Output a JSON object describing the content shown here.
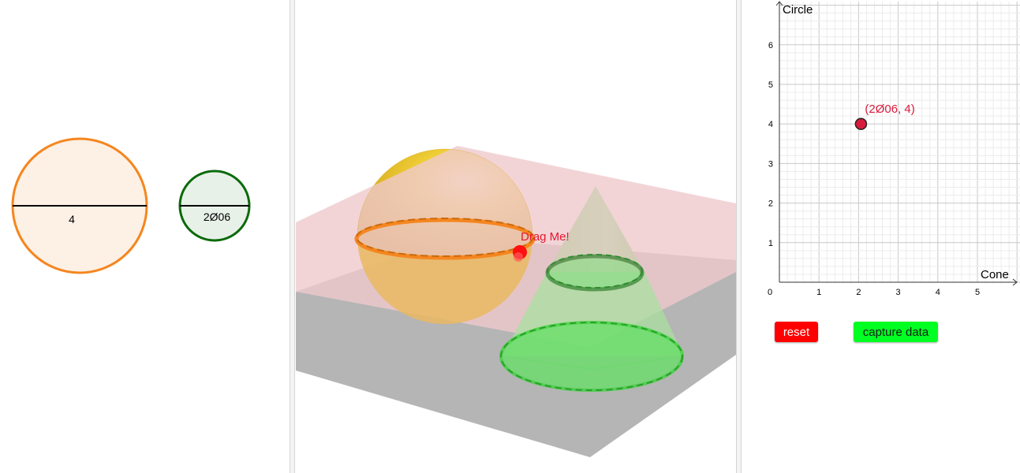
{
  "left": {
    "circle1_label": "4",
    "circle2_label": "2Ø06",
    "circle1_color": "#f5861f",
    "circle1_fill": "#fdf0e5",
    "circle2_color": "#0b6a0b",
    "circle2_fill": "#e8f1e8"
  },
  "scene3d": {
    "drag_label": "Drag Me!",
    "sphere_color": "#e8c12a",
    "cone_color": "#5edb5e",
    "plane_color": "#efc9cd",
    "ground_color": "#b5b5b5"
  },
  "graph": {
    "ylabel": "Circle",
    "xlabel": "Cone",
    "point_label": "(2Ø06, 4)",
    "point_color": "#d81b3c",
    "x_ticks": [
      "0",
      "1",
      "2",
      "3",
      "4",
      "5"
    ],
    "y_ticks": [
      "1",
      "2",
      "3",
      "4",
      "5",
      "6"
    ],
    "point": {
      "x": 2.06,
      "y": 4
    }
  },
  "buttons": {
    "reset_label": "reset",
    "reset_color": "#ff0000",
    "capture_label": "capture data",
    "capture_color": "#00ff22"
  }
}
